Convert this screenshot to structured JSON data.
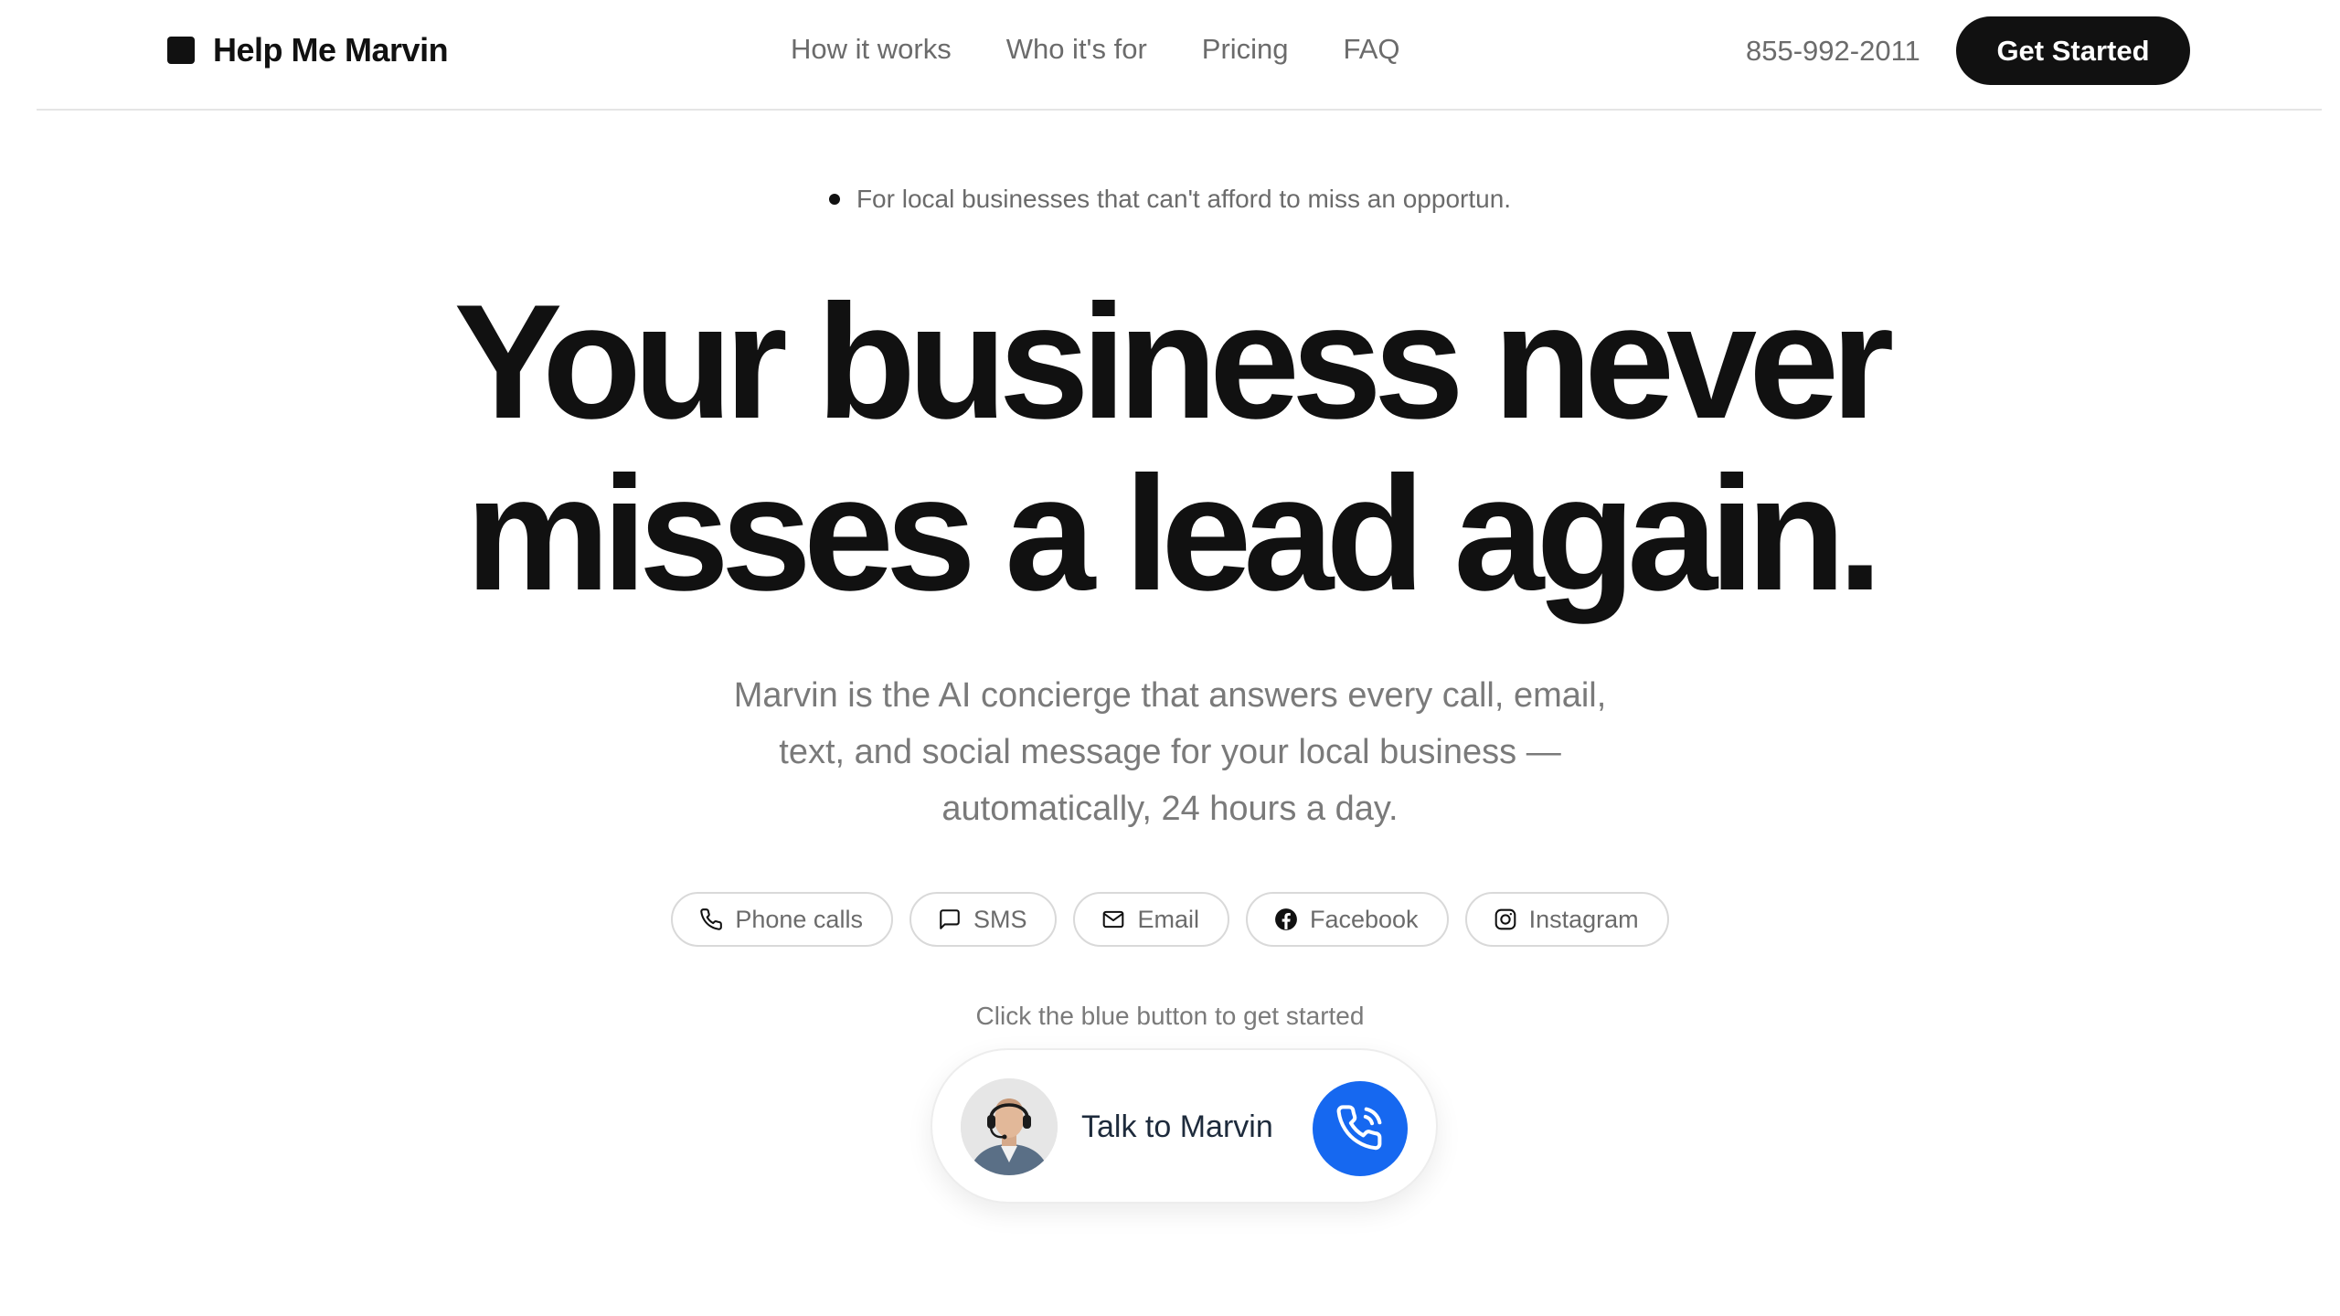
{
  "header": {
    "brand_name": "Help Me Marvin",
    "nav": [
      {
        "label": "How it works"
      },
      {
        "label": "Who it's for"
      },
      {
        "label": "Pricing"
      },
      {
        "label": "FAQ"
      }
    ],
    "phone": "855-992-2011",
    "cta_label": "Get Started"
  },
  "hero": {
    "eyebrow": "For local businesses that can't afford to miss an opportun.",
    "headline_line1": "Your business never",
    "headline_line2": "misses a lead again.",
    "subtitle_line1": "Marvin is the AI concierge that answers every call, email,",
    "subtitle_line2": "text, and social message for your local business —",
    "subtitle_line3": "automatically, 24 hours a day."
  },
  "channels": [
    {
      "label": "Phone calls",
      "icon": "phone-icon"
    },
    {
      "label": "SMS",
      "icon": "message-icon"
    },
    {
      "label": "Email",
      "icon": "mail-icon"
    },
    {
      "label": "Facebook",
      "icon": "facebook-icon"
    },
    {
      "label": "Instagram",
      "icon": "instagram-icon"
    }
  ],
  "call": {
    "hint": "Click the blue button to get started",
    "label": "Talk to Marvin",
    "button_icon": "phone-call-icon",
    "button_color": "#1668f0"
  },
  "colors": {
    "text_primary": "#111111",
    "text_muted": "#6b6b6b",
    "border": "#d9d9d9",
    "accent_blue": "#1668f0"
  }
}
